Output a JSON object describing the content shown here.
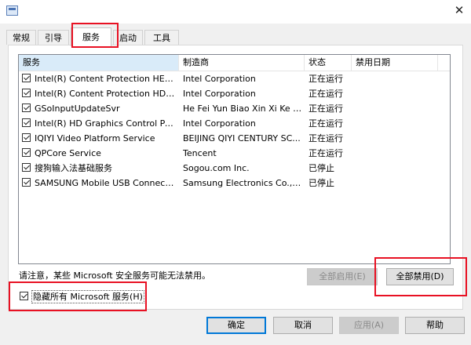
{
  "window": {
    "close_glyph": "✕"
  },
  "tabs": [
    {
      "label": "常规"
    },
    {
      "label": "引导"
    },
    {
      "label": "服务"
    },
    {
      "label": "启动"
    },
    {
      "label": "工具"
    }
  ],
  "services": {
    "columns": [
      "服务",
      "制造商",
      "状态",
      "禁用日期"
    ],
    "rows": [
      {
        "name": "Intel(R) Content Protection HECI ...",
        "vendor": "Intel Corporation",
        "status": "正在运行",
        "date": "",
        "checked": true
      },
      {
        "name": "Intel(R) Content Protection HDCP...",
        "vendor": "Intel Corporation",
        "status": "正在运行",
        "date": "",
        "checked": true
      },
      {
        "name": "GSoInputUpdateSvr",
        "vendor": "He Fei Yun Biao Xin Xi Ke J...",
        "status": "正在运行",
        "date": "",
        "checked": true
      },
      {
        "name": "Intel(R) HD Graphics Control Pan...",
        "vendor": "Intel Corporation",
        "status": "正在运行",
        "date": "",
        "checked": true
      },
      {
        "name": "IQIYI Video Platform Service",
        "vendor": "BEIJING QIYI CENTURY SC...",
        "status": "正在运行",
        "date": "",
        "checked": true
      },
      {
        "name": "QPCore Service",
        "vendor": "Tencent",
        "status": "正在运行",
        "date": "",
        "checked": true
      },
      {
        "name": "搜狗输入法基础服务",
        "vendor": "Sogou.com Inc.",
        "status": "已停止",
        "date": "",
        "checked": true
      },
      {
        "name": "SAMSUNG Mobile USB Connecti...",
        "vendor": "Samsung Electronics Co., L...",
        "status": "已停止",
        "date": "",
        "checked": true
      }
    ]
  },
  "notice": "请注意，某些 Microsoft 安全服务可能无法禁用。",
  "buttons": {
    "enable_all": "全部启用(E)",
    "disable_all": "全部禁用(D)",
    "ok": "确定",
    "cancel": "取消",
    "apply": "应用(A)",
    "help": "帮助"
  },
  "hide_ms": {
    "label": "隐藏所有 Microsoft 服务(H)",
    "checked": true
  },
  "colors": {
    "highlight": "#e81123",
    "accent": "#0078d7",
    "header_selected": "#d9ebf9"
  }
}
